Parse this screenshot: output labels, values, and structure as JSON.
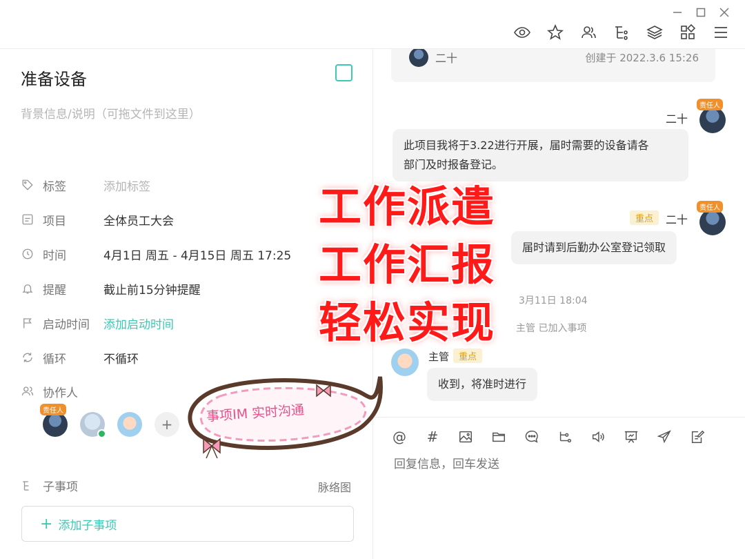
{
  "task": {
    "title": "准备设备",
    "description_placeholder": "背景信息/说明（可拖文件到这里）"
  },
  "fields": {
    "tags": {
      "label": "标签",
      "value": "添加标签"
    },
    "project": {
      "label": "项目",
      "value": "全体员工大会"
    },
    "time": {
      "label": "时间",
      "value": "4月1日 周五  - 4月15日 周五 17:25"
    },
    "reminder": {
      "label": "提醒",
      "value": "截止前15分钟提醒"
    },
    "start_time": {
      "label": "启动时间",
      "value": "添加启动时间"
    },
    "repeat": {
      "label": "循环",
      "value": "不循环"
    },
    "collaborators": {
      "label": "协作人",
      "owner_badge": "责任人",
      "add_symbol": "+"
    }
  },
  "subtasks": {
    "label": "子事项",
    "mindmap_link": "脉络图",
    "add_label": "添加子事项",
    "add_symbol": "+"
  },
  "chat": {
    "created": {
      "name": "二十",
      "time": "创建于 2022.3.6 15:26"
    },
    "messages": [
      {
        "name": "二十",
        "badge": "责任人",
        "text_line1": "此项目我将于3.22进行开展，届时需要的设备请各",
        "text_line2": "部门及时报备登记。"
      },
      {
        "name": "二十",
        "badge": "责任人",
        "tag": "重点",
        "text": "届时请到后勤办公室登记领取"
      },
      {
        "name": "主管",
        "tag": "重点",
        "text": "收到，将准时进行"
      }
    ],
    "timestamp": "3月11日 18:04",
    "system_note": "主管 已加入事项",
    "compose_placeholder": "回复信息，回车发送"
  },
  "promo": {
    "lines": [
      "工作派遣",
      "工作汇报",
      "轻松实现"
    ],
    "sticker_text": "事项IM  实时沟通"
  },
  "colors": {
    "accent": "#3cc8b4",
    "important_bg": "#fbf0cf",
    "important_text": "#d8a020",
    "promo_red": "#ff1a1a",
    "sticker_pink": "#e8508a"
  },
  "icons": {
    "toolbar": [
      "eye-icon",
      "star-icon",
      "members-icon",
      "tree-icon",
      "layers-icon",
      "apps-icon",
      "menu-icon"
    ],
    "compose": [
      "at-icon",
      "hash-icon",
      "image-icon",
      "folder-icon",
      "chat-icon",
      "branch-icon",
      "voice-icon",
      "presentation-icon",
      "send-icon",
      "note-icon"
    ]
  }
}
